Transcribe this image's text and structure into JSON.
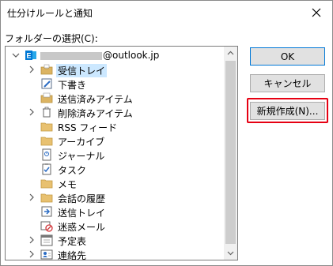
{
  "window": {
    "title": "仕分けルールと通知"
  },
  "folder_select": {
    "label": "フォルダーの選択(C):"
  },
  "account": {
    "suffix": "@outlook.jp"
  },
  "tree": [
    {
      "label": "受信トレイ",
      "icon": "inbox-icon"
    },
    {
      "label": "下書き",
      "icon": "drafts-icon"
    },
    {
      "label": "送信済みアイテム",
      "icon": "sent-items-icon"
    },
    {
      "label": "削除済みアイテム",
      "icon": "trash-icon"
    },
    {
      "label": "RSS フィード",
      "icon": "rss-icon"
    },
    {
      "label": "アーカイブ",
      "icon": "archive-folder-icon"
    },
    {
      "label": "ジャーナル",
      "icon": "journal-icon"
    },
    {
      "label": "タスク",
      "icon": "task-icon"
    },
    {
      "label": "メモ",
      "icon": "note-icon"
    },
    {
      "label": "会話の履歴",
      "icon": "conversation-history-icon"
    },
    {
      "label": "送信トレイ",
      "icon": "outbox-icon"
    },
    {
      "label": "迷惑メール",
      "icon": "junk-mail-icon"
    },
    {
      "label": "予定表",
      "icon": "calendar-icon"
    },
    {
      "label": "連絡先",
      "icon": "contacts-icon"
    }
  ],
  "buttons": {
    "ok": "OK",
    "cancel": "キャンセル",
    "new": "新規作成(N)..."
  },
  "colors": {
    "selection": "#cce8ff",
    "highlight_border": "#e60012",
    "account_blue": "#0078d4"
  }
}
